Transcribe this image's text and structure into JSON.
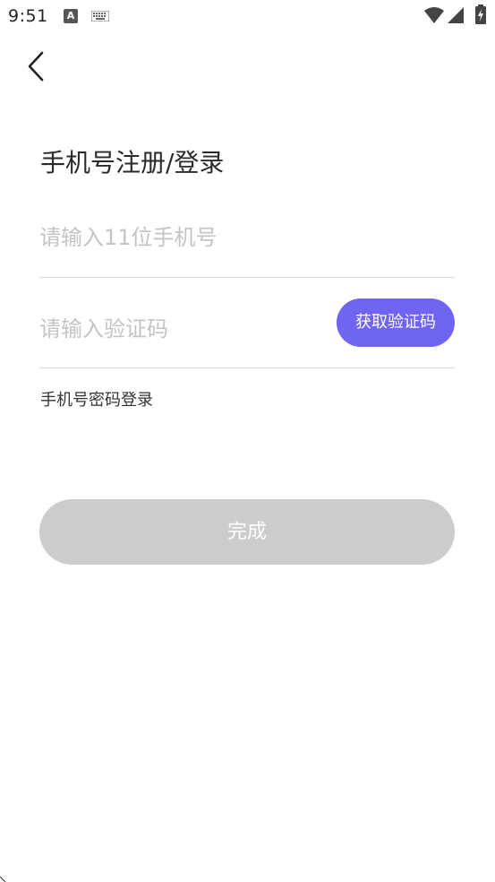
{
  "status_bar": {
    "time": "9:51",
    "a_badge": "A"
  },
  "page": {
    "title": "手机号注册/登录"
  },
  "form": {
    "phone": {
      "value": "",
      "placeholder": "请输入11位手机号"
    },
    "code": {
      "value": "",
      "placeholder": "请输入验证码"
    },
    "get_code_label": "获取验证码",
    "password_login_label": "手机号密码登录",
    "submit_label": "完成"
  },
  "colors": {
    "accent": "#7065f0",
    "disabled_button": "#cccccc",
    "placeholder": "#c4c4c4",
    "divider": "#dddddd"
  }
}
